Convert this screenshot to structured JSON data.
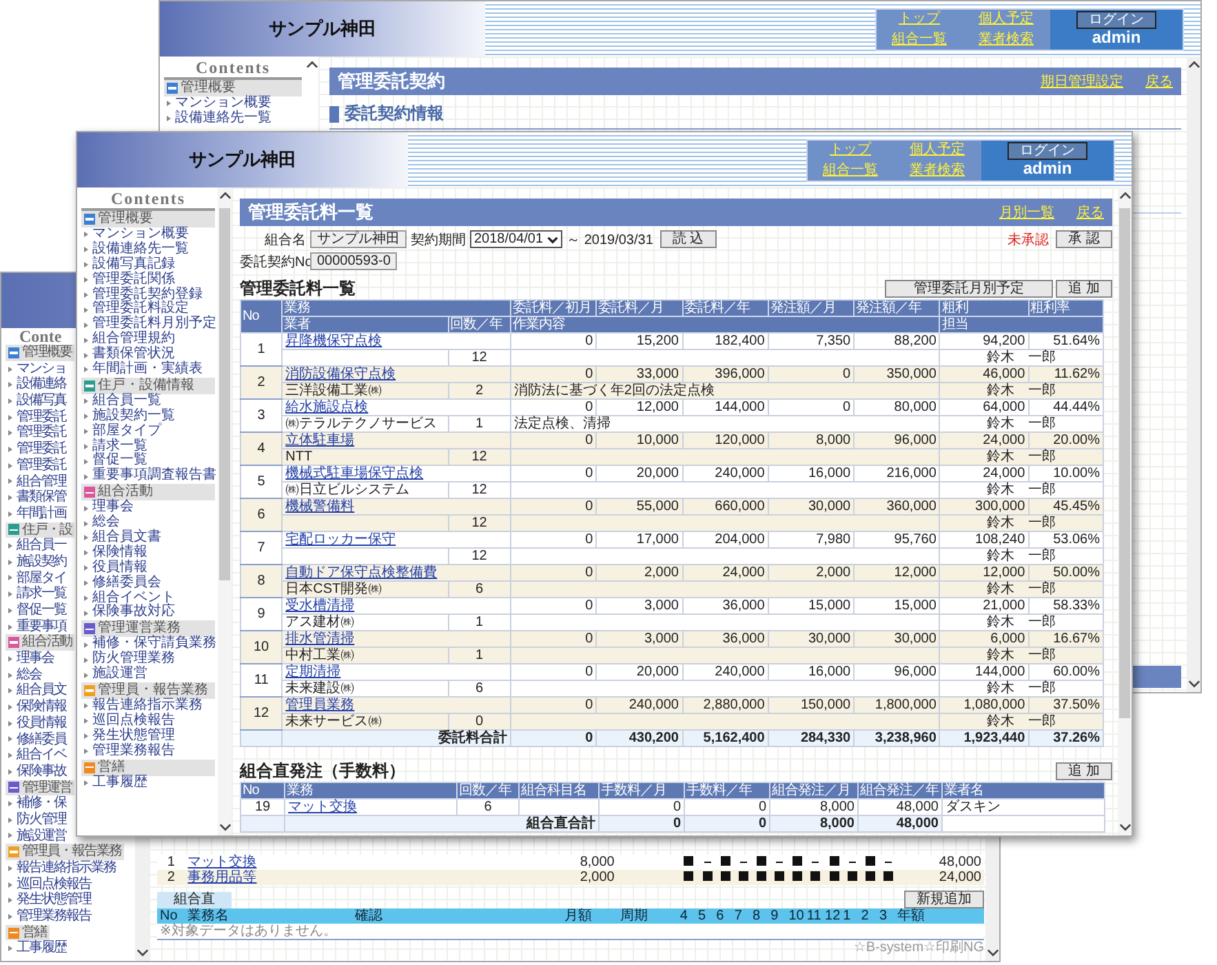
{
  "back_window": {
    "title": "サンプル神田",
    "nav": [
      "トップ",
      "個人予定",
      "組合一覧",
      "業者検索"
    ],
    "login_button": "ログイン",
    "user": "admin",
    "contents_heading": "Contents",
    "sidebar": [
      {
        "kind": "section",
        "text": "管理概要",
        "color": "#3b7fd4"
      },
      {
        "kind": "item",
        "text": "マンション概要"
      },
      {
        "kind": "item",
        "text": "設備連絡先一覧"
      }
    ],
    "page_title": "管理委託契約",
    "links": [
      "期日管理設定",
      "戻る"
    ],
    "heading": "委託契約情報"
  },
  "left_window": {
    "contents_heading": "Conte",
    "sidebar": [
      {
        "kind": "section",
        "text": "管理概要",
        "color": "#3b7fd4"
      },
      {
        "kind": "item",
        "text": "マンショ"
      },
      {
        "kind": "item",
        "text": "設備連絡"
      },
      {
        "kind": "item",
        "text": "設備写真"
      },
      {
        "kind": "item",
        "text": "管理委託"
      },
      {
        "kind": "item",
        "text": "管理委託"
      },
      {
        "kind": "item",
        "text": "管理委託"
      },
      {
        "kind": "item",
        "text": "管理委託"
      },
      {
        "kind": "item",
        "text": "組合管理"
      },
      {
        "kind": "item",
        "text": "書類保管"
      },
      {
        "kind": "item",
        "text": "年間計画"
      },
      {
        "kind": "section",
        "text": "住戸・設",
        "color": "#2a9d8f"
      },
      {
        "kind": "item",
        "text": "組合員一"
      },
      {
        "kind": "item",
        "text": "施設契約"
      },
      {
        "kind": "item",
        "text": "部屋タイ"
      },
      {
        "kind": "item",
        "text": "請求一覧"
      },
      {
        "kind": "item",
        "text": "督促一覧"
      },
      {
        "kind": "item",
        "text": "重要事項"
      },
      {
        "kind": "section",
        "text": "組合活動",
        "color": "#d9589a"
      },
      {
        "kind": "item",
        "text": "理事会"
      },
      {
        "kind": "item",
        "text": "総会"
      },
      {
        "kind": "item",
        "text": "組合員文"
      },
      {
        "kind": "item",
        "text": "保険情報"
      },
      {
        "kind": "item",
        "text": "役員情報"
      },
      {
        "kind": "item",
        "text": "修繕委員"
      },
      {
        "kind": "item",
        "text": "組合イベ"
      },
      {
        "kind": "item",
        "text": "保険事故"
      },
      {
        "kind": "section",
        "text": "管理運営",
        "color": "#6a5acd"
      },
      {
        "kind": "item",
        "text": "補修・保"
      },
      {
        "kind": "item",
        "text": "防火管理"
      },
      {
        "kind": "item",
        "text": "施設運営"
      },
      {
        "kind": "section",
        "text": "管理員・報告業務",
        "color": "#f0a020"
      },
      {
        "kind": "item",
        "text": "報告連絡指示業務"
      },
      {
        "kind": "item",
        "text": "巡回点検報告"
      },
      {
        "kind": "item",
        "text": "発生状態管理"
      },
      {
        "kind": "item",
        "text": "管理業務報告"
      },
      {
        "kind": "section",
        "text": "営繕",
        "color": "#f08a20"
      },
      {
        "kind": "item",
        "text": "工事履歴"
      }
    ],
    "rows": [
      {
        "no": "1",
        "task": "マット交換",
        "monthly": "8,000",
        "months": [
          true,
          false,
          true,
          false,
          true,
          false,
          true,
          false,
          true,
          false,
          true,
          false
        ],
        "annual": "48,000"
      },
      {
        "no": "2",
        "task": "事務用品等",
        "monthly": "2,000",
        "months": [
          true,
          true,
          true,
          true,
          true,
          true,
          true,
          true,
          true,
          true,
          true,
          true
        ],
        "annual": "24,000"
      }
    ],
    "tab": "組合直",
    "add_button": "新規追加",
    "columns": [
      "No",
      "業務名",
      "確認",
      "月額",
      "周期",
      "4",
      "5",
      "6",
      "7",
      "8",
      "9",
      "10",
      "11",
      "12",
      "1",
      "2",
      "3",
      "年額"
    ],
    "empty_message": "※対象データはありません。",
    "footer": "☆B-system☆印刷NG"
  },
  "front_window": {
    "title": "サンプル神田",
    "nav": [
      "トップ",
      "個人予定",
      "組合一覧",
      "業者検索"
    ],
    "login_button": "ログイン",
    "user": "admin",
    "contents_heading": "Contents",
    "sidebar": [
      {
        "title": "管理概要",
        "color": "#3b7fd4",
        "items": [
          "マンション概要",
          "設備連絡先一覧",
          "設備写真記録",
          "管理委託関係",
          "管理委託契約登録",
          "管理委託料設定",
          "管理委託料月別予定",
          "組合管理規約",
          "書類保管状況",
          "年間計画・実績表"
        ]
      },
      {
        "title": "住戸・設備情報",
        "color": "#2a9d8f",
        "items": [
          "組合員一覧",
          "施設契約一覧",
          "部屋タイプ",
          "請求一覧",
          "督促一覧",
          "重要事項調査報告書"
        ]
      },
      {
        "title": "組合活動",
        "color": "#d9589a",
        "items": [
          "理事会",
          "総会",
          "組合員文書",
          "保険情報",
          "役員情報",
          "修繕委員会",
          "組合イベント",
          "保険事故対応"
        ]
      },
      {
        "title": "管理運営業務",
        "color": "#6a5acd",
        "items": [
          "補修・保守請負業務",
          "防火管理業務",
          "施設運営"
        ]
      },
      {
        "title": "管理員・報告業務",
        "color": "#f0a020",
        "items": [
          "報告連絡指示業務",
          "巡回点検報告",
          "発生状態管理",
          "管理業務報告"
        ]
      },
      {
        "title": "営繕",
        "color": "#f08a20",
        "items": [
          "工事履歴"
        ]
      }
    ],
    "page_title": "管理委託料一覧",
    "header_links": [
      "月別一覧",
      "戻る"
    ],
    "form": {
      "union_label": "組合名",
      "union_value": "サンプル神田",
      "period_label": "契約期間",
      "period_start": "2018/04/01",
      "period_end": "～ 2019/03/31",
      "load_button": "読 込",
      "status": "未承認",
      "approve_button": "承 認",
      "contract_label": "委託契約No",
      "contract_no": "00000593-0"
    },
    "fee_table": {
      "title": "管理委託料一覧",
      "buttons": [
        "管理委託月別予定",
        "追 加"
      ],
      "header_top": [
        "No",
        "業務",
        "委託料／初月",
        "委託料／月",
        "委託料／年",
        "発注額／月",
        "発注額／年",
        "粗利",
        "粗利率"
      ],
      "header_bottom": [
        "業者",
        "回数／年",
        "作業内容",
        "担当"
      ],
      "rows": [
        {
          "no": "1",
          "task": "昇降機保守点検",
          "count": "12",
          "initial": "0",
          "monthly": "15,200",
          "annual": "182,400",
          "order_monthly": "7,350",
          "order_annual": "88,200",
          "profit": "94,200",
          "rate": "51.64%",
          "staff": "鈴木　一郎"
        },
        {
          "no": "2",
          "task": "消防設備保守点検",
          "vendor": "三洋設備工業㈱",
          "count": "2",
          "work": "消防法に基づく年2回の法定点検",
          "initial": "0",
          "monthly": "33,000",
          "annual": "396,000",
          "order_monthly": "0",
          "order_annual": "350,000",
          "profit": "46,000",
          "rate": "11.62%",
          "staff": "鈴木　一郎"
        },
        {
          "no": "3",
          "task": "給水施設点検",
          "vendor": "㈱テラルテクノサービス",
          "count": "1",
          "work": "法定点検、清掃",
          "initial": "0",
          "monthly": "12,000",
          "annual": "144,000",
          "order_monthly": "0",
          "order_annual": "80,000",
          "profit": "64,000",
          "rate": "44.44%",
          "staff": "鈴木　一郎"
        },
        {
          "no": "4",
          "task": "立体駐車場",
          "vendor": "NTT",
          "count": "12",
          "initial": "0",
          "monthly": "10,000",
          "annual": "120,000",
          "order_monthly": "8,000",
          "order_annual": "96,000",
          "profit": "24,000",
          "rate": "20.00%",
          "staff": "鈴木　一郎"
        },
        {
          "no": "5",
          "task": "機械式駐車場保守点検",
          "vendor": "㈱日立ビルシステム",
          "count": "12",
          "initial": "0",
          "monthly": "20,000",
          "annual": "240,000",
          "order_monthly": "16,000",
          "order_annual": "216,000",
          "profit": "24,000",
          "rate": "10.00%",
          "staff": "鈴木　一郎"
        },
        {
          "no": "6",
          "task": "機械警備料",
          "count": "12",
          "initial": "0",
          "monthly": "55,000",
          "annual": "660,000",
          "order_monthly": "30,000",
          "order_annual": "360,000",
          "profit": "300,000",
          "rate": "45.45%",
          "staff": "鈴木　一郎"
        },
        {
          "no": "7",
          "task": "宅配ロッカー保守",
          "count": "12",
          "initial": "0",
          "monthly": "17,000",
          "annual": "204,000",
          "order_monthly": "7,980",
          "order_annual": "95,760",
          "profit": "108,240",
          "rate": "53.06%",
          "staff": "鈴木　一郎"
        },
        {
          "no": "8",
          "task": "自動ドア保守点検整備費",
          "vendor": "日本CST開発㈱",
          "count": "6",
          "initial": "0",
          "monthly": "2,000",
          "annual": "24,000",
          "order_monthly": "2,000",
          "order_annual": "12,000",
          "profit": "12,000",
          "rate": "50.00%",
          "staff": "鈴木　一郎"
        },
        {
          "no": "9",
          "task": "受水槽清掃",
          "vendor": "アス建材㈱",
          "count": "1",
          "initial": "0",
          "monthly": "3,000",
          "annual": "36,000",
          "order_monthly": "15,000",
          "order_annual": "15,000",
          "profit": "21,000",
          "rate": "58.33%",
          "staff": "鈴木　一郎"
        },
        {
          "no": "10",
          "task": "排水管清掃",
          "vendor": "中村工業㈱",
          "count": "1",
          "initial": "0",
          "monthly": "3,000",
          "annual": "36,000",
          "order_monthly": "30,000",
          "order_annual": "30,000",
          "profit": "6,000",
          "rate": "16.67%",
          "staff": "鈴木　一郎"
        },
        {
          "no": "11",
          "task": "定期清掃",
          "vendor": "未来建設㈱",
          "count": "6",
          "initial": "0",
          "monthly": "20,000",
          "annual": "240,000",
          "order_monthly": "16,000",
          "order_annual": "96,000",
          "profit": "144,000",
          "rate": "60.00%",
          "staff": "鈴木　一郎"
        },
        {
          "no": "12",
          "task": "管理員業務",
          "vendor": "未来サービス㈱",
          "count": "0",
          "initial": "0",
          "monthly": "240,000",
          "annual": "2,880,000",
          "order_monthly": "150,000",
          "order_annual": "1,800,000",
          "profit": "1,080,000",
          "rate": "37.50%",
          "staff": "鈴木　一郎"
        }
      ],
      "total": {
        "label": "委託料合計",
        "initial": "0",
        "monthly": "430,200",
        "annual": "5,162,400",
        "order_monthly": "284,330",
        "order_annual": "3,238,960",
        "profit": "1,923,440",
        "rate": "37.26%"
      }
    },
    "direct_table": {
      "title": "組合直発注（手数料）",
      "add_button": "追 加",
      "columns": [
        "No",
        "業務",
        "回数／年",
        "組合科目名",
        "手数料／月",
        "手数料／年",
        "組合発注／月",
        "組合発注／年",
        "業者名"
      ],
      "rows": [
        {
          "no": "19",
          "task": "マット交換",
          "count": "6",
          "fee_monthly": "0",
          "fee_annual": "0",
          "order_monthly": "8,000",
          "order_annual": "48,000",
          "vendor": "ダスキン"
        }
      ],
      "total": {
        "label": "組合直合計",
        "fee_monthly": "0",
        "fee_annual": "0",
        "order_monthly": "8,000",
        "order_annual": "48,000"
      }
    }
  }
}
